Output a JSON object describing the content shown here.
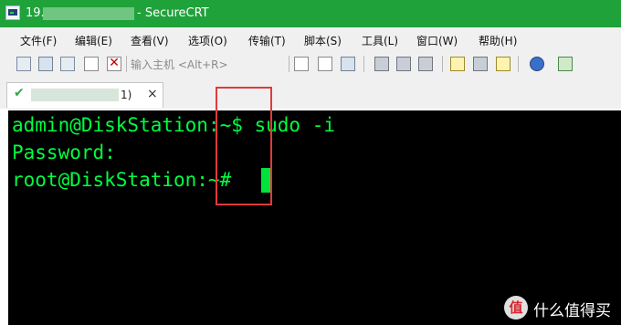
{
  "window": {
    "title_prefix": "19.",
    "title": "- SecureCRT"
  },
  "menu": [
    "文件(F)",
    "编辑(E)",
    "查看(V)",
    "选项(O)",
    "传输(T)",
    "脚本(S)",
    "工具(L)",
    "窗口(W)",
    "帮助(H)"
  ],
  "toolbar": {
    "quick_connect_placeholder": "输入主机 <Alt+R>",
    "icons": [
      "connect-icon",
      "quick-connect-icon",
      "clone-session-icon",
      "reconnect-icon",
      "disconnect-icon",
      "copy-icon",
      "paste-icon",
      "find-icon",
      "print-icon",
      "print-selection-icon",
      "print-setup-icon",
      "session-options-icon",
      "global-options-icon",
      "keymap-icon",
      "help-icon",
      "sftp-icon"
    ]
  },
  "tab": {
    "label": "1)",
    "close": "×",
    "status": "connected",
    "status_color": "#2fa84a"
  },
  "terminal": {
    "lines": [
      "admin@DiskStation:~$ sudo -i",
      "Password:",
      "root@DiskStation:~#"
    ],
    "text_color": "#00ff41",
    "background": "#000000"
  },
  "annotation": {
    "color": "#e23a3a"
  },
  "watermark": {
    "logo": "值",
    "text": "什么值得买"
  }
}
